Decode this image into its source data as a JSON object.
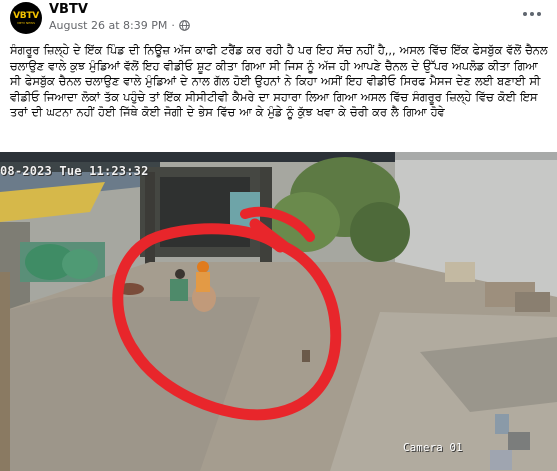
{
  "post": {
    "page_name": "VBTV",
    "timestamp": "August 26 at 8:39 PM",
    "separator": "·",
    "avatar_logo": "VBTV",
    "avatar_sub": "VBTV NEWS",
    "text": "ਸੰਗਰੂਰ ਜ਼ਿਲ੍ਹੇ ਦੇ ਇੱਕ ਪਿੰਡ ਦੀ ਨਿਊਜ਼ ਅੱਜ ਕਾਫੀ ਟਰੈਂਡ ਕਰ ਰਹੀ ਹੈ ਪਰ ਇਹ ਸੱਚ ਨਹੀਂ ਹੈ,,, ਅਸਲ ਵਿੱਚ ਇੱਕ ਫੇਸਬੁੱਕ ਵੱਲੋਂ ਚੈਨਲ ਚਲਾਉਣ ਵਾਲੇ ਕੁਝ ਮੁੰਡਿਆਂ ਵੱਲੋਂ ਇਹ ਵੀਡੀਓ ਸ਼ੂਟ ਕੀਤਾ ਗਿਆ ਸੀ ਜਿਸ ਨੂੰ ਅੱਜ ਹੀ ਆਪਣੇ ਚੈਨਲ ਦੇ ਉੱਪਰ ਅਪਲੋਡ ਕੀਤਾ ਗਿਆ ਸੀ ਫੇਸਬੁੱਕ ਚੈਨਲ ਚਲਾਉਣ ਵਾਲੇ ਮੁੰਡਿਆਂ ਦੇ ਨਾਲ ਗੱਲ ਹੋਈ ਉਹਨਾਂ ਨੇ ਕਿਹਾ ਅਸੀਂ ਇਹ ਵੀਡੀਓ ਸਿਰਫ ਮੈਸਜ ਦੇਣ ਲਈ ਬਣਾਈ ਸੀ ਵੀਡੀਓ ਜਿਆਦਾ ਲੋਕਾਂ ਤੱਕ ਪਹੁੰਚੇ ਤਾਂ ਇੱਕ ਸੀਸੀਟੀਵੀ ਕੈਮਰੇ ਦਾ ਸਹਾਰਾ ਲਿਆ ਗਿਆ ਅਸਲ ਵਿੱਚ ਸੰਗਰੂਰ ਜ਼ਿਲ੍ਹੇ ਵਿੱਚ ਕੋਈ ਇਸ ਤਰਾਂ ਦੀ ਘਟਨਾ ਨਹੀਂ ਹੋਈ ਜਿੱਥੇ ਕੋਈ ਜੋਗੀ ਦੇ ਭੇਸ ਵਿੱਚ ਆ ਕੇ ਮੁੰਡੇ ਨੂੰ ਕੁੱਝ ਖਵਾ ਕੇ ਚੋਰੀ ਕਰ ਲੈ ਗਿਆ ਹੋਵੇ"
  },
  "media": {
    "timestamp_overlay": "08-2023 Tue 11:23:32",
    "camera_label": "Camera 01",
    "annotation_color": "#e8262b"
  },
  "icons": {
    "globe": "globe-icon",
    "more": "more-options-icon"
  }
}
